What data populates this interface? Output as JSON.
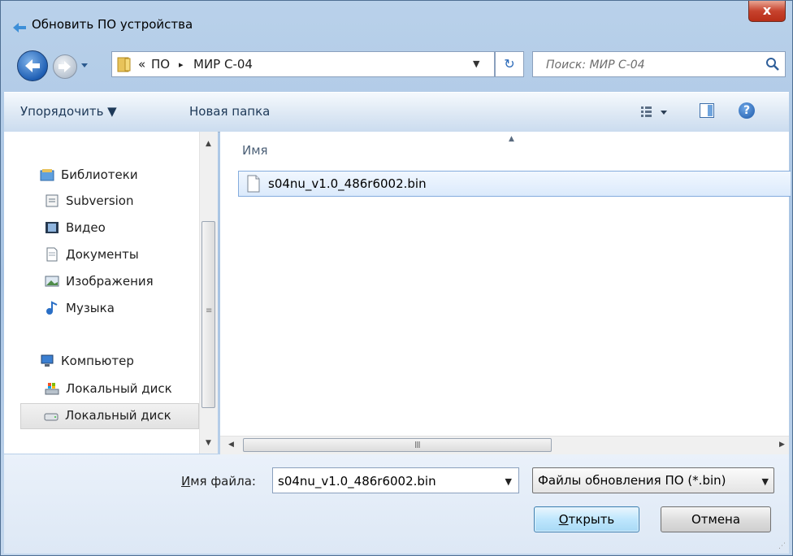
{
  "window": {
    "title": "Обновить ПО устройства",
    "close_label": "x"
  },
  "address": {
    "overflow": "«",
    "separator": "▸",
    "crumbs": [
      "ПО",
      "МИР С-04"
    ],
    "refresh_glyph": "↻"
  },
  "search": {
    "placeholder": "Поиск: МИР С-04"
  },
  "toolbar": {
    "organize_label": "Упорядочить ▼",
    "new_folder_label": "Новая папка"
  },
  "nav_pane": {
    "libraries": {
      "label": "Библиотеки",
      "icon": "libraries-icon"
    },
    "library_items": [
      {
        "label": "Subversion",
        "icon": "subversion-icon"
      },
      {
        "label": "Видео",
        "icon": "video-icon"
      },
      {
        "label": "Документы",
        "icon": "documents-icon"
      },
      {
        "label": "Изображения",
        "icon": "pictures-icon"
      },
      {
        "label": "Музыка",
        "icon": "music-icon"
      }
    ],
    "computer": {
      "label": "Компьютер",
      "icon": "computer-icon"
    },
    "drives": [
      {
        "label": "Локальный диск",
        "icon": "system-drive-icon",
        "selected": false
      },
      {
        "label": "Локальный диск",
        "icon": "drive-icon",
        "selected": true
      }
    ]
  },
  "file_list": {
    "column_name": "Имя",
    "files": [
      {
        "name": "s04nu_v1.0_486r6002.bin",
        "icon": "file-icon",
        "selected": true
      }
    ],
    "scroll_grip": "III"
  },
  "bottom": {
    "filename_label_underlined": "И",
    "filename_label_rest": "мя файла:",
    "filename_value": "s04nu_v1.0_486r6002.bin",
    "file_type": "Файлы обновления ПО (*.bin)",
    "open_label_underlined": "О",
    "open_label_rest": "ткрыть",
    "cancel_label": "Отмена"
  },
  "colors": {
    "accent": "#3c7fb1",
    "frame": "#a6c2e2",
    "selection": "#dbeafc",
    "close": "#c7432e"
  }
}
